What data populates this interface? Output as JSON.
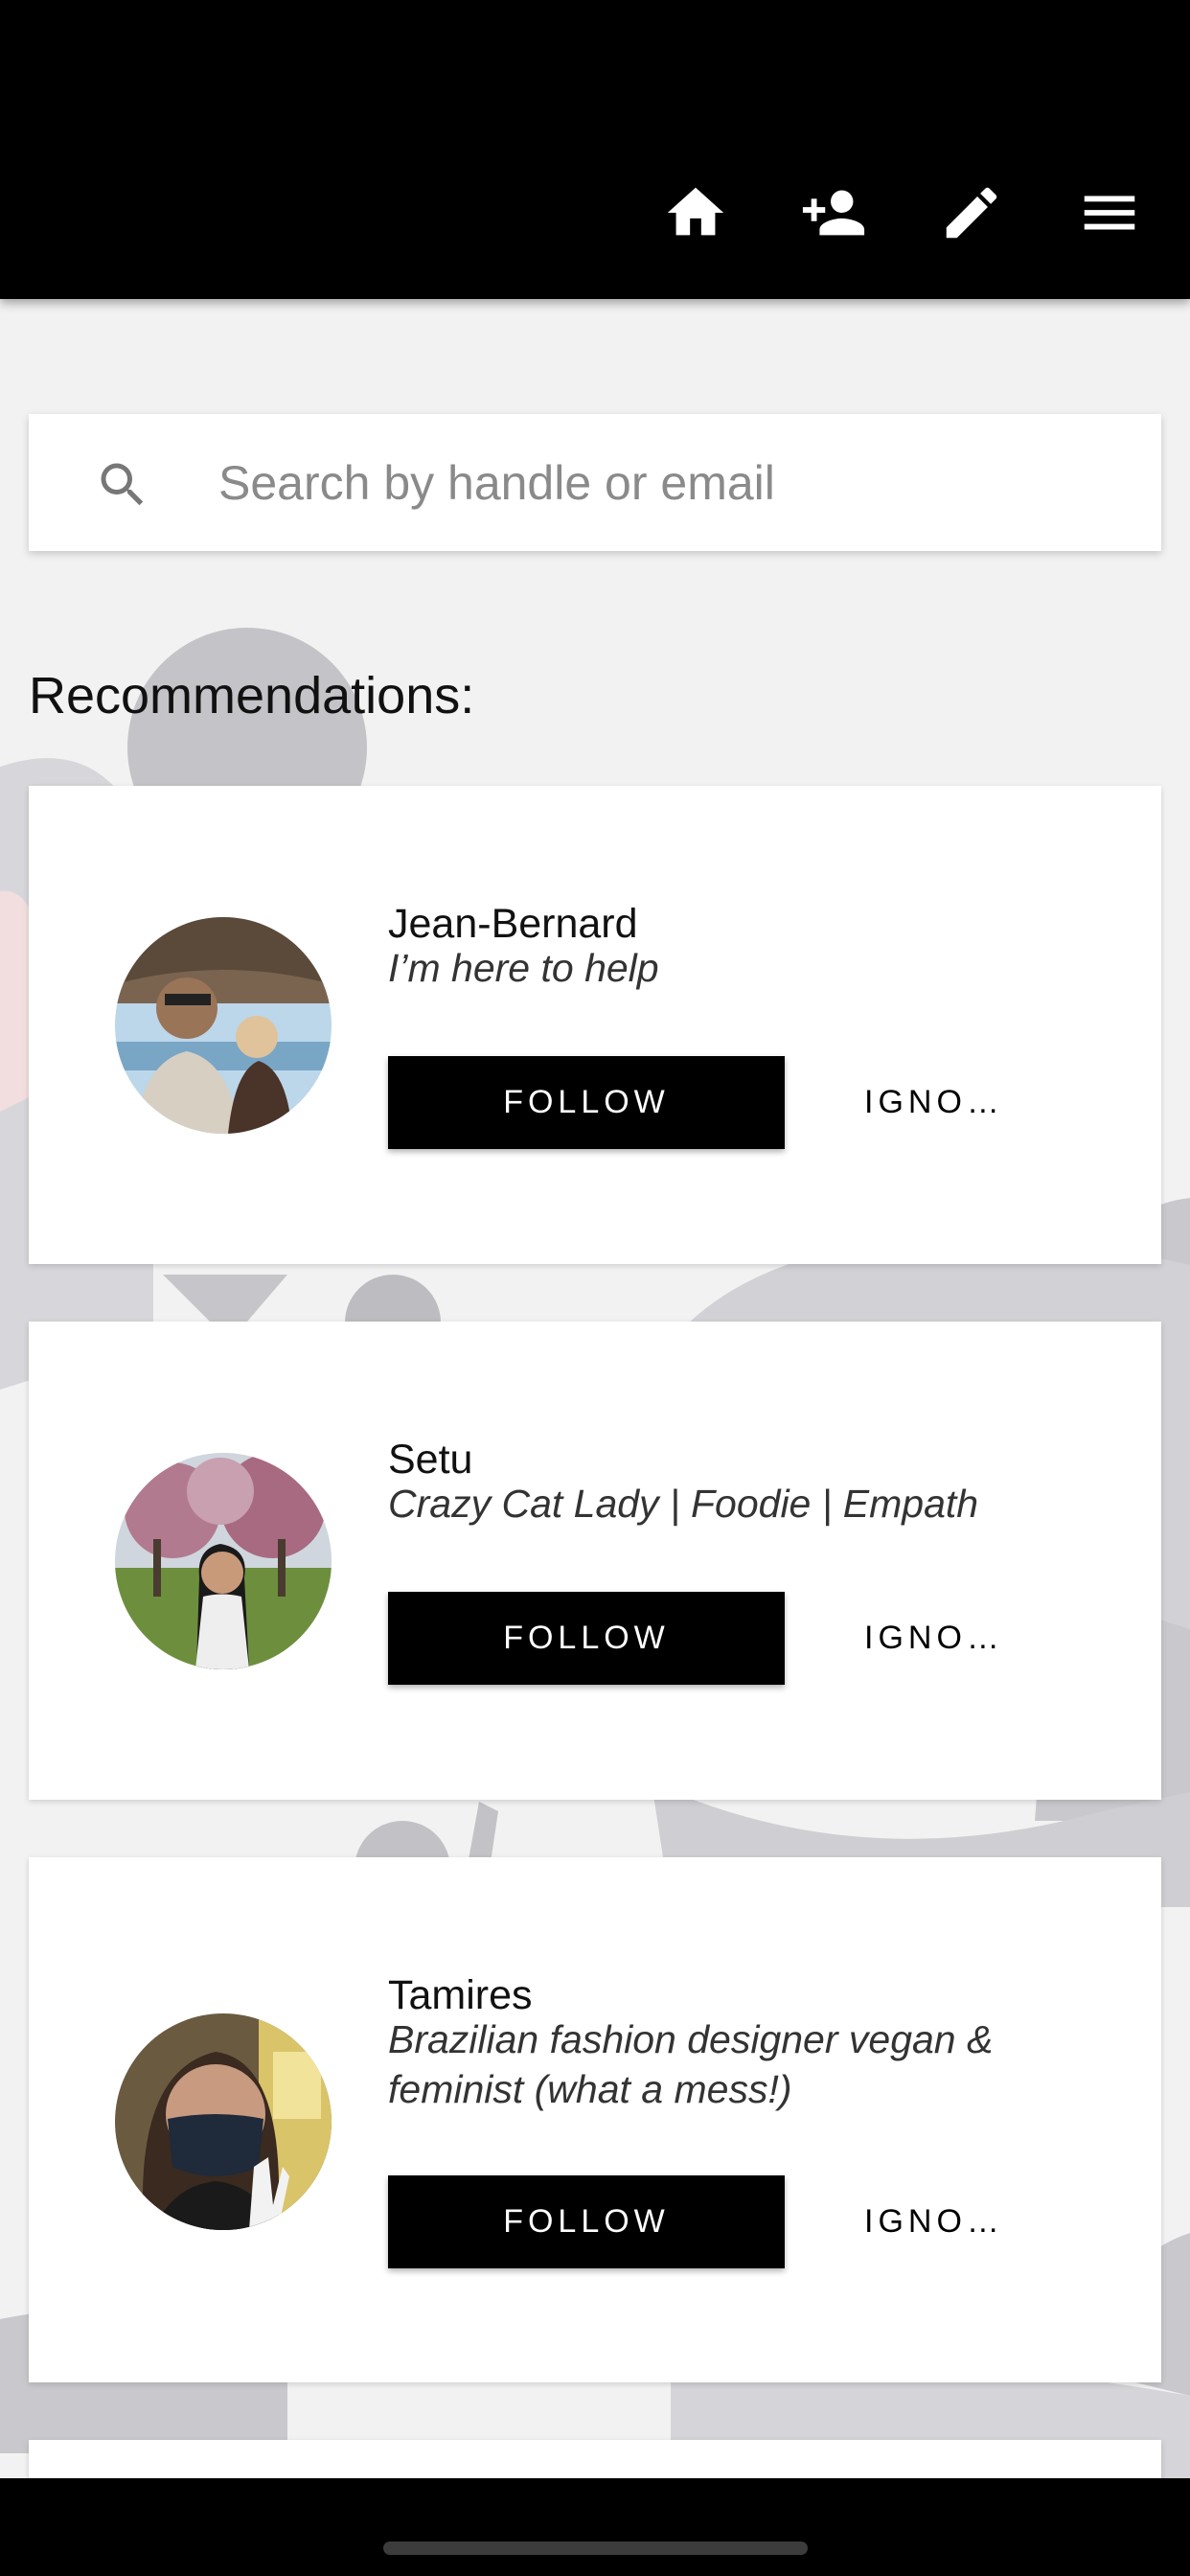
{
  "nav": {
    "icons": [
      "home-icon",
      "person-add-icon",
      "pencil-icon",
      "menu-icon"
    ]
  },
  "search": {
    "placeholder": "Search by handle or email",
    "value": ""
  },
  "recommendations": {
    "heading": "Recommendations:",
    "users": [
      {
        "name": "Jean-Bernard",
        "bio": "I’m here to help",
        "follow_label": "FOLLOW",
        "ignore_label": "IGNO…"
      },
      {
        "name": "Setu",
        "bio": "Crazy Cat Lady | Foodie | Empath",
        "follow_label": "FOLLOW",
        "ignore_label": "IGNO…"
      },
      {
        "name": "Tamires",
        "bio": "Brazilian fashion designer vegan & feminist (what a mess!)",
        "follow_label": "FOLLOW",
        "ignore_label": "IGNO…"
      }
    ]
  },
  "colors": {
    "topbar": "#000000",
    "background": "#f2f2f2",
    "card": "#ffffff",
    "button": "#000000",
    "placeholder": "#8a8a8a"
  }
}
